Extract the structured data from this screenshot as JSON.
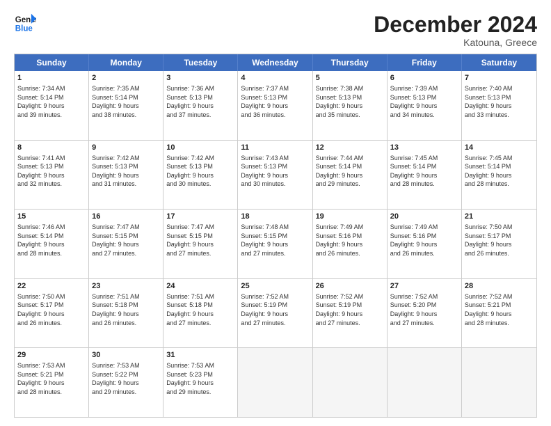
{
  "header": {
    "logo_line1": "General",
    "logo_line2": "Blue",
    "month_title": "December 2024",
    "subtitle": "Katouna, Greece"
  },
  "weekdays": [
    "Sunday",
    "Monday",
    "Tuesday",
    "Wednesday",
    "Thursday",
    "Friday",
    "Saturday"
  ],
  "rows": [
    [
      {
        "day": "1",
        "info": "Sunrise: 7:34 AM\nSunset: 5:14 PM\nDaylight: 9 hours\nand 39 minutes."
      },
      {
        "day": "2",
        "info": "Sunrise: 7:35 AM\nSunset: 5:14 PM\nDaylight: 9 hours\nand 38 minutes."
      },
      {
        "day": "3",
        "info": "Sunrise: 7:36 AM\nSunset: 5:13 PM\nDaylight: 9 hours\nand 37 minutes."
      },
      {
        "day": "4",
        "info": "Sunrise: 7:37 AM\nSunset: 5:13 PM\nDaylight: 9 hours\nand 36 minutes."
      },
      {
        "day": "5",
        "info": "Sunrise: 7:38 AM\nSunset: 5:13 PM\nDaylight: 9 hours\nand 35 minutes."
      },
      {
        "day": "6",
        "info": "Sunrise: 7:39 AM\nSunset: 5:13 PM\nDaylight: 9 hours\nand 34 minutes."
      },
      {
        "day": "7",
        "info": "Sunrise: 7:40 AM\nSunset: 5:13 PM\nDaylight: 9 hours\nand 33 minutes."
      }
    ],
    [
      {
        "day": "8",
        "info": "Sunrise: 7:41 AM\nSunset: 5:13 PM\nDaylight: 9 hours\nand 32 minutes."
      },
      {
        "day": "9",
        "info": "Sunrise: 7:42 AM\nSunset: 5:13 PM\nDaylight: 9 hours\nand 31 minutes."
      },
      {
        "day": "10",
        "info": "Sunrise: 7:42 AM\nSunset: 5:13 PM\nDaylight: 9 hours\nand 30 minutes."
      },
      {
        "day": "11",
        "info": "Sunrise: 7:43 AM\nSunset: 5:13 PM\nDaylight: 9 hours\nand 30 minutes."
      },
      {
        "day": "12",
        "info": "Sunrise: 7:44 AM\nSunset: 5:14 PM\nDaylight: 9 hours\nand 29 minutes."
      },
      {
        "day": "13",
        "info": "Sunrise: 7:45 AM\nSunset: 5:14 PM\nDaylight: 9 hours\nand 28 minutes."
      },
      {
        "day": "14",
        "info": "Sunrise: 7:45 AM\nSunset: 5:14 PM\nDaylight: 9 hours\nand 28 minutes."
      }
    ],
    [
      {
        "day": "15",
        "info": "Sunrise: 7:46 AM\nSunset: 5:14 PM\nDaylight: 9 hours\nand 28 minutes."
      },
      {
        "day": "16",
        "info": "Sunrise: 7:47 AM\nSunset: 5:15 PM\nDaylight: 9 hours\nand 27 minutes."
      },
      {
        "day": "17",
        "info": "Sunrise: 7:47 AM\nSunset: 5:15 PM\nDaylight: 9 hours\nand 27 minutes."
      },
      {
        "day": "18",
        "info": "Sunrise: 7:48 AM\nSunset: 5:15 PM\nDaylight: 9 hours\nand 27 minutes."
      },
      {
        "day": "19",
        "info": "Sunrise: 7:49 AM\nSunset: 5:16 PM\nDaylight: 9 hours\nand 26 minutes."
      },
      {
        "day": "20",
        "info": "Sunrise: 7:49 AM\nSunset: 5:16 PM\nDaylight: 9 hours\nand 26 minutes."
      },
      {
        "day": "21",
        "info": "Sunrise: 7:50 AM\nSunset: 5:17 PM\nDaylight: 9 hours\nand 26 minutes."
      }
    ],
    [
      {
        "day": "22",
        "info": "Sunrise: 7:50 AM\nSunset: 5:17 PM\nDaylight: 9 hours\nand 26 minutes."
      },
      {
        "day": "23",
        "info": "Sunrise: 7:51 AM\nSunset: 5:18 PM\nDaylight: 9 hours\nand 26 minutes."
      },
      {
        "day": "24",
        "info": "Sunrise: 7:51 AM\nSunset: 5:18 PM\nDaylight: 9 hours\nand 27 minutes."
      },
      {
        "day": "25",
        "info": "Sunrise: 7:52 AM\nSunset: 5:19 PM\nDaylight: 9 hours\nand 27 minutes."
      },
      {
        "day": "26",
        "info": "Sunrise: 7:52 AM\nSunset: 5:19 PM\nDaylight: 9 hours\nand 27 minutes."
      },
      {
        "day": "27",
        "info": "Sunrise: 7:52 AM\nSunset: 5:20 PM\nDaylight: 9 hours\nand 27 minutes."
      },
      {
        "day": "28",
        "info": "Sunrise: 7:52 AM\nSunset: 5:21 PM\nDaylight: 9 hours\nand 28 minutes."
      }
    ],
    [
      {
        "day": "29",
        "info": "Sunrise: 7:53 AM\nSunset: 5:21 PM\nDaylight: 9 hours\nand 28 minutes."
      },
      {
        "day": "30",
        "info": "Sunrise: 7:53 AM\nSunset: 5:22 PM\nDaylight: 9 hours\nand 29 minutes."
      },
      {
        "day": "31",
        "info": "Sunrise: 7:53 AM\nSunset: 5:23 PM\nDaylight: 9 hours\nand 29 minutes."
      },
      {
        "day": "",
        "info": ""
      },
      {
        "day": "",
        "info": ""
      },
      {
        "day": "",
        "info": ""
      },
      {
        "day": "",
        "info": ""
      }
    ]
  ]
}
